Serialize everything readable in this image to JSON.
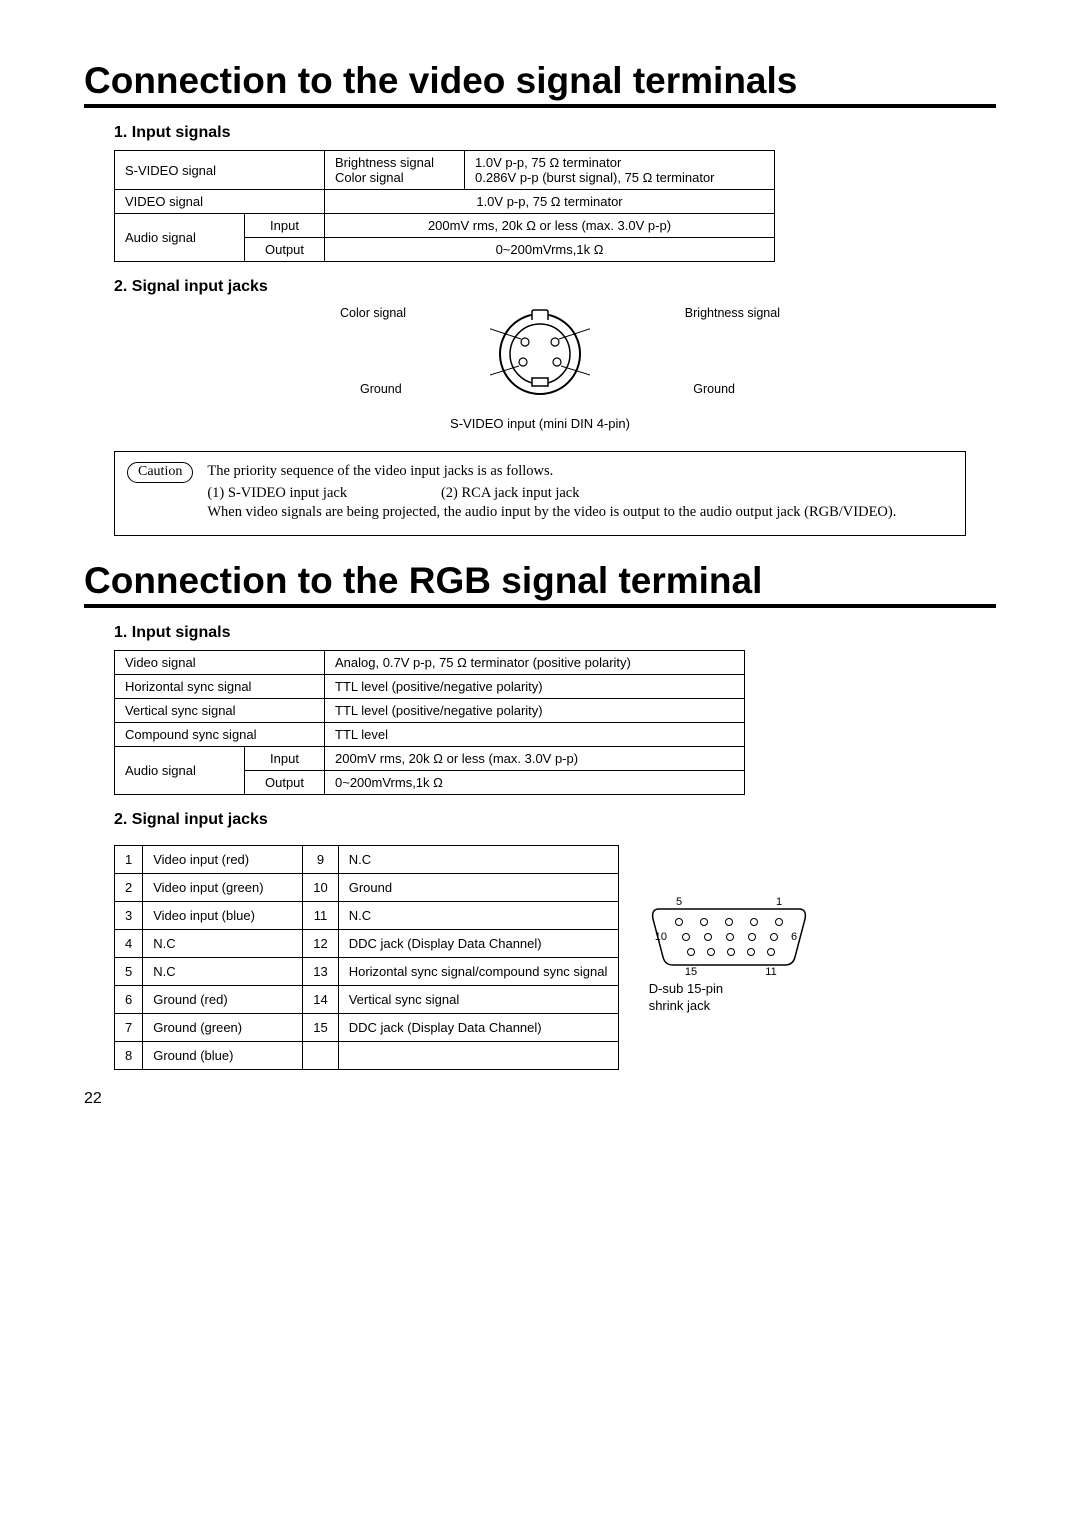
{
  "section1": {
    "title": "Connection to the video signal terminals",
    "h_input": "1. Input signals",
    "table": {
      "r1": {
        "name": "S-VIDEO signal",
        "sub1": "Brightness signal",
        "sub2": "Color signal",
        "val1": "1.0V p-p, 75 Ω terminator",
        "val2": "0.286V p-p (burst signal), 75 Ω terminator"
      },
      "r2": {
        "name": "VIDEO signal",
        "val": "1.0V p-p, 75 Ω terminator"
      },
      "r3": {
        "name": "Audio signal",
        "sub_in": "Input",
        "val_in": "200mV rms, 20k Ω or less (max. 3.0V p-p)",
        "sub_out": "Output",
        "val_out": "0~200mVrms,1k Ω"
      }
    },
    "h_jacks": "2. Signal input jacks",
    "jack_labels": {
      "color": "Color signal",
      "bright": "Brightness signal",
      "gnd_l": "Ground",
      "gnd_r": "Ground"
    },
    "jack_caption": "S-VIDEO input (mini DIN 4-pin)",
    "caution": {
      "label": "Caution",
      "line1": "The priority sequence of the video input jacks is as follows.",
      "jack1": "(1) S-VIDEO input jack",
      "jack2": "(2) RCA jack input jack",
      "line2": "When video signals are being projected, the audio input by the video is output to the audio output jack (RGB/VIDEO)."
    }
  },
  "section2": {
    "title": "Connection to the RGB signal terminal",
    "h_input": "1. Input signals",
    "table": {
      "r1": {
        "name": "Video signal",
        "val": "Analog, 0.7V p-p, 75 Ω terminator (positive polarity)"
      },
      "r2": {
        "name": "Horizontal sync signal",
        "val": "TTL level (positive/negative polarity)"
      },
      "r3": {
        "name": "Vertical sync signal",
        "val": "TTL level (positive/negative polarity)"
      },
      "r4": {
        "name": "Compound sync signal",
        "val": "TTL level"
      },
      "r5": {
        "name": "Audio signal",
        "sub_in": "Input",
        "val_in": "200mV rms, 20k Ω or less (max. 3.0V p-p)",
        "sub_out": "Output",
        "val_out": "0~200mVrms,1k Ω"
      }
    },
    "h_jacks": "2. Signal input jacks",
    "pins": [
      {
        "n": "1",
        "d": "Video input (red)"
      },
      {
        "n": "2",
        "d": "Video input (green)"
      },
      {
        "n": "3",
        "d": "Video input (blue)"
      },
      {
        "n": "4",
        "d": "N.C"
      },
      {
        "n": "5",
        "d": "N.C"
      },
      {
        "n": "6",
        "d": "Ground (red)"
      },
      {
        "n": "7",
        "d": "Ground (green)"
      },
      {
        "n": "8",
        "d": "Ground (blue)"
      },
      {
        "n": "9",
        "d": "N.C"
      },
      {
        "n": "10",
        "d": "Ground"
      },
      {
        "n": "11",
        "d": "N.C"
      },
      {
        "n": "12",
        "d": "DDC jack (Display Data Channel)"
      },
      {
        "n": "13",
        "d": "Horizontal sync signal/compound sync signal"
      },
      {
        "n": "14",
        "d": "Vertical sync signal"
      },
      {
        "n": "15",
        "d": "DDC jack (Display Data Channel)"
      }
    ],
    "dsub": {
      "labels": {
        "p1": "1",
        "p5": "5",
        "p6": "6",
        "p10": "10",
        "p11": "11",
        "p15": "15"
      },
      "caption1": "D-sub 15-pin",
      "caption2": "shrink jack"
    }
  },
  "page_number": "22"
}
